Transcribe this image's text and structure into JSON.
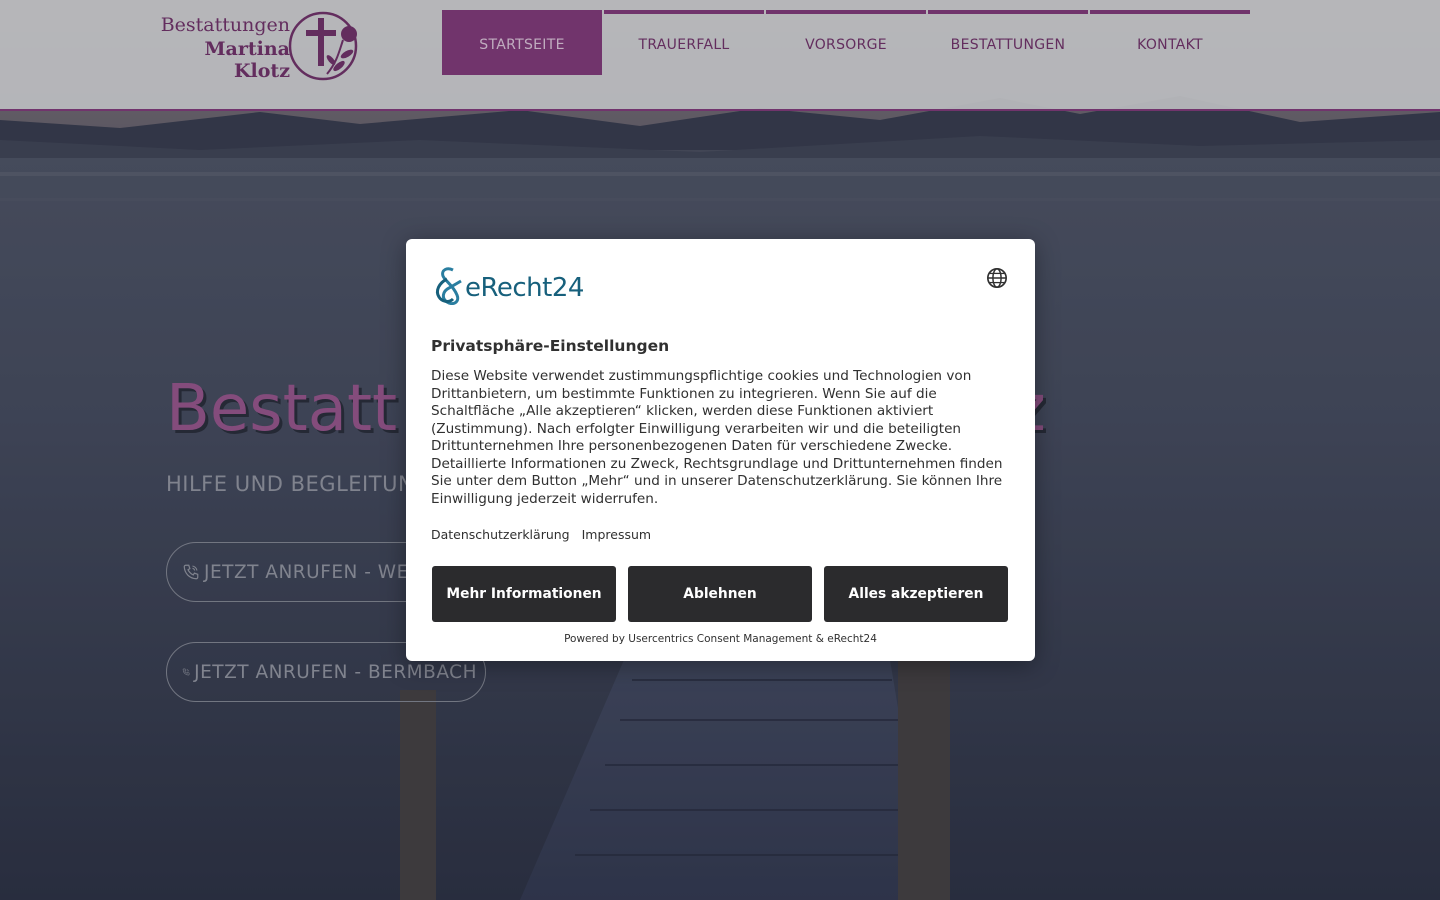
{
  "header": {
    "logo": {
      "line1": "Bestattungen",
      "line2": "Martina Klotz"
    },
    "nav": [
      {
        "label": "STARTSEITE",
        "active": true
      },
      {
        "label": "TRAUERFALL",
        "active": false
      },
      {
        "label": "VORSORGE",
        "active": false
      },
      {
        "label": "BESTATTUNGEN",
        "active": false
      },
      {
        "label": "KONTAKT",
        "active": false
      }
    ]
  },
  "hero": {
    "title_visible_left": "Bestatt",
    "title_visible_right": "z",
    "subtitle_visible": "HILFE UND BEGLEITUN",
    "call_buttons": [
      {
        "label": "JETZT ANRUFEN - WE"
      },
      {
        "label": "JETZT ANRUFEN - BERMBACH"
      }
    ]
  },
  "consent": {
    "brand": "eRecht24",
    "title": "Privatsphäre-Einstellungen",
    "text": "Diese Website verwendet zustimmungspflichtige cookies und Technologien von Drittanbietern, um bestimmte Funktionen zu integrieren. Wenn Sie auf die Schaltfläche „Alle akzeptieren“ klicken, werden diese Funktionen aktiviert (Zustimmung). Nach erfolgter Einwilligung verarbeiten wir und die beteiligten Drittunternehmen Ihre personenbezogenen Daten für verschiedene Zwecke. Detaillierte Informationen zu Zweck, Rechtsgrundlage und Drittunternehmen finden Sie unter dem Button „Mehr“ und in unserer Datenschutzerklärung. Sie können Ihre Einwilligung jederzeit widerrufen.",
    "links": {
      "privacy": "Datenschutzerklärung",
      "imprint": "Impressum"
    },
    "buttons": {
      "more": "Mehr Informationen",
      "deny": "Ablehnen",
      "accept": "Alles akzeptieren"
    },
    "powered_by": "Powered by Usercentrics Consent Management & eRecht24"
  },
  "colors": {
    "brand_purple": "#8c3d82",
    "dialog_button": "#2b2b2d",
    "erecht_teal": "#17607c"
  }
}
